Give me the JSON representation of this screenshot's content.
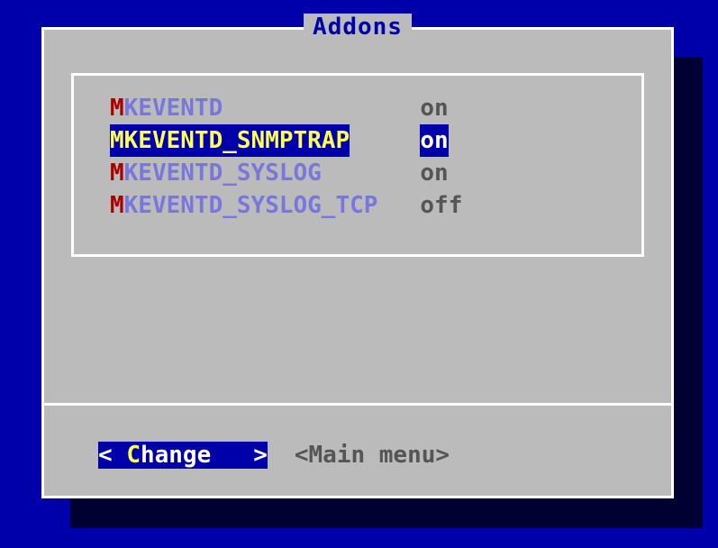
{
  "title": "Addons",
  "items": [
    {
      "hotkey": "M",
      "label": "KEVENTD",
      "status": "on",
      "selected": false
    },
    {
      "hotkey": "M",
      "label": "KEVENTD_SNMPTRAP",
      "status": "on",
      "selected": true
    },
    {
      "hotkey": "M",
      "label": "KEVENTD_SYSLOG",
      "status": "on",
      "selected": false
    },
    {
      "hotkey": "M",
      "label": "KEVENTD_SYSLOG_TCP",
      "status": "off",
      "selected": false
    }
  ],
  "buttons": {
    "change": {
      "pre": "< ",
      "hotkey": "C",
      "label": "hange   >",
      "selected": true
    },
    "mainmenu": {
      "text": "<Main menu>",
      "selected": false
    }
  }
}
